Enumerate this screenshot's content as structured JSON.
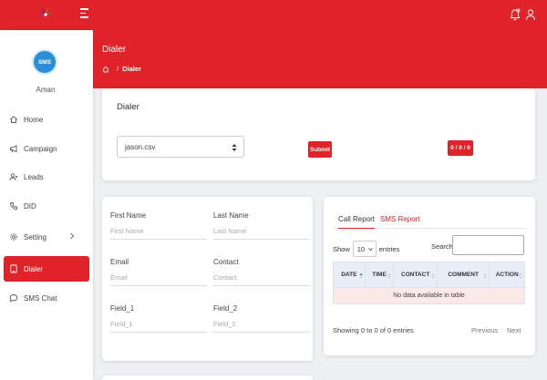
{
  "header": {
    "notification_badge_color": "#f7b2b4"
  },
  "sidebar": {
    "avatar_text": "SMS",
    "username": "Aman",
    "items": [
      {
        "label": "Home",
        "icon": "home-icon"
      },
      {
        "label": "Campaign",
        "icon": "megaphone-icon"
      },
      {
        "label": "Leads",
        "icon": "users-icon"
      },
      {
        "label": "DID",
        "icon": "phone-icon"
      },
      {
        "label": "Setting",
        "icon": "gear-icon"
      },
      {
        "label": "Dialer",
        "icon": "phone-square-icon",
        "active": true
      },
      {
        "label": "SMS Chat",
        "icon": "chat-icon"
      }
    ]
  },
  "banner": {
    "title": "Dialer",
    "breadcrumb_current": "Dialer"
  },
  "dialer_card": {
    "title": "Dialer",
    "selected_file": "jason.csv",
    "submit_label": "Submit",
    "counter": "0 / 0 / 0"
  },
  "form": {
    "first_name": {
      "label": "First Name",
      "placeholder": "First Name"
    },
    "last_name": {
      "label": "Last Name",
      "placeholder": "Last Name"
    },
    "email": {
      "label": "Email",
      "placeholder": "Email"
    },
    "contact": {
      "label": "Contact",
      "placeholder": "Contact"
    },
    "field_1": {
      "label": "Field_1",
      "placeholder": "Field_1"
    },
    "field_2": {
      "label": "Field_2",
      "placeholder": "Field_2"
    }
  },
  "report": {
    "tabs": [
      "Call Report",
      "SMS Report"
    ],
    "show_label": "Show",
    "entries_value": "10",
    "entries_label": "entries",
    "search_label": "Search:",
    "columns": [
      "DATE",
      "TIME",
      "CONTACT",
      "COMMENT",
      "ACTION"
    ],
    "empty_text": "No data available in table",
    "info": "Showing 0 to 0 of 0 entries",
    "prev_label": "Previous",
    "next_label": "Next"
  },
  "colors": {
    "brand_red": "#df2329",
    "background": "#eef0f3",
    "table_header": "#e8edf7"
  }
}
